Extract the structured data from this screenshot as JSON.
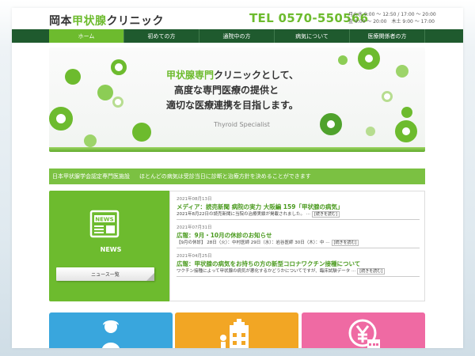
{
  "header": {
    "logo_pre": "岡本",
    "logo_accent": "甲状腺",
    "logo_post": "クリニック",
    "tel": "TEL 0570-550566",
    "hours_line1": "月火水 9:00 ～ 12:50 / 17:00 ～ 20:00",
    "hours_line2": "金 9:00 ～ 20:00　木土 9:00 ～ 17:00"
  },
  "nav": {
    "items": [
      {
        "label": "ホーム"
      },
      {
        "label": "初めての方"
      },
      {
        "label": "通院中の方"
      },
      {
        "label": "病気について"
      },
      {
        "label": "医療関係者の方"
      }
    ]
  },
  "hero": {
    "line1_accent": "甲状腺専門",
    "line1_rest": "クリニックとして、",
    "line2": "高度な専門医療の提供と",
    "line3": "適切な医療連携を目指します。",
    "subtitle": "Thyroid Specialist"
  },
  "banner": {
    "left": "日本甲状腺学会認定専門医施設",
    "right": "ほとんどの病気は受診当日に診断と治療方針を決めることができます"
  },
  "news_box": {
    "icon_text": "NEWS",
    "label": "NEWS",
    "button": "ニュース一覧"
  },
  "news": [
    {
      "date": "2021年08月13日",
      "title": "メディア：読売新聞 病院の実力 大阪編 159「甲状腺の病気」",
      "excerpt": "2021年8月22日の読売新聞に当院の治療実績が掲載されました。 ···",
      "more": "[続きを読む]"
    },
    {
      "date": "2021年07月31日",
      "title": "広報：9月・10月の休診のお知らせ",
      "excerpt": "【9月の休診】 28日（火）：中村医師 29日（水）：岩谷医師 30日（木）：中 ···",
      "more": "[続きを読む]"
    },
    {
      "date": "2021年04月25日",
      "title": "広報：甲状腺の病気をお持ちの方の新型コロナワクチン接種について",
      "excerpt": "ワクチン接種によって甲状腺の病気が悪化するかどうかについてですが、臨床試験データ ···",
      "more": "[続きを読む]"
    }
  ],
  "cards": [
    {
      "icon": "person-icon",
      "color": "#39a6dd"
    },
    {
      "icon": "hospital-icon",
      "color": "#f2a624"
    },
    {
      "icon": "yen-calendar-icon",
      "color": "#ef6aa3"
    }
  ],
  "colors": {
    "accent": "#6dbb2e",
    "nav_bg": "#1f5a2e",
    "banner": "#7bc142"
  }
}
